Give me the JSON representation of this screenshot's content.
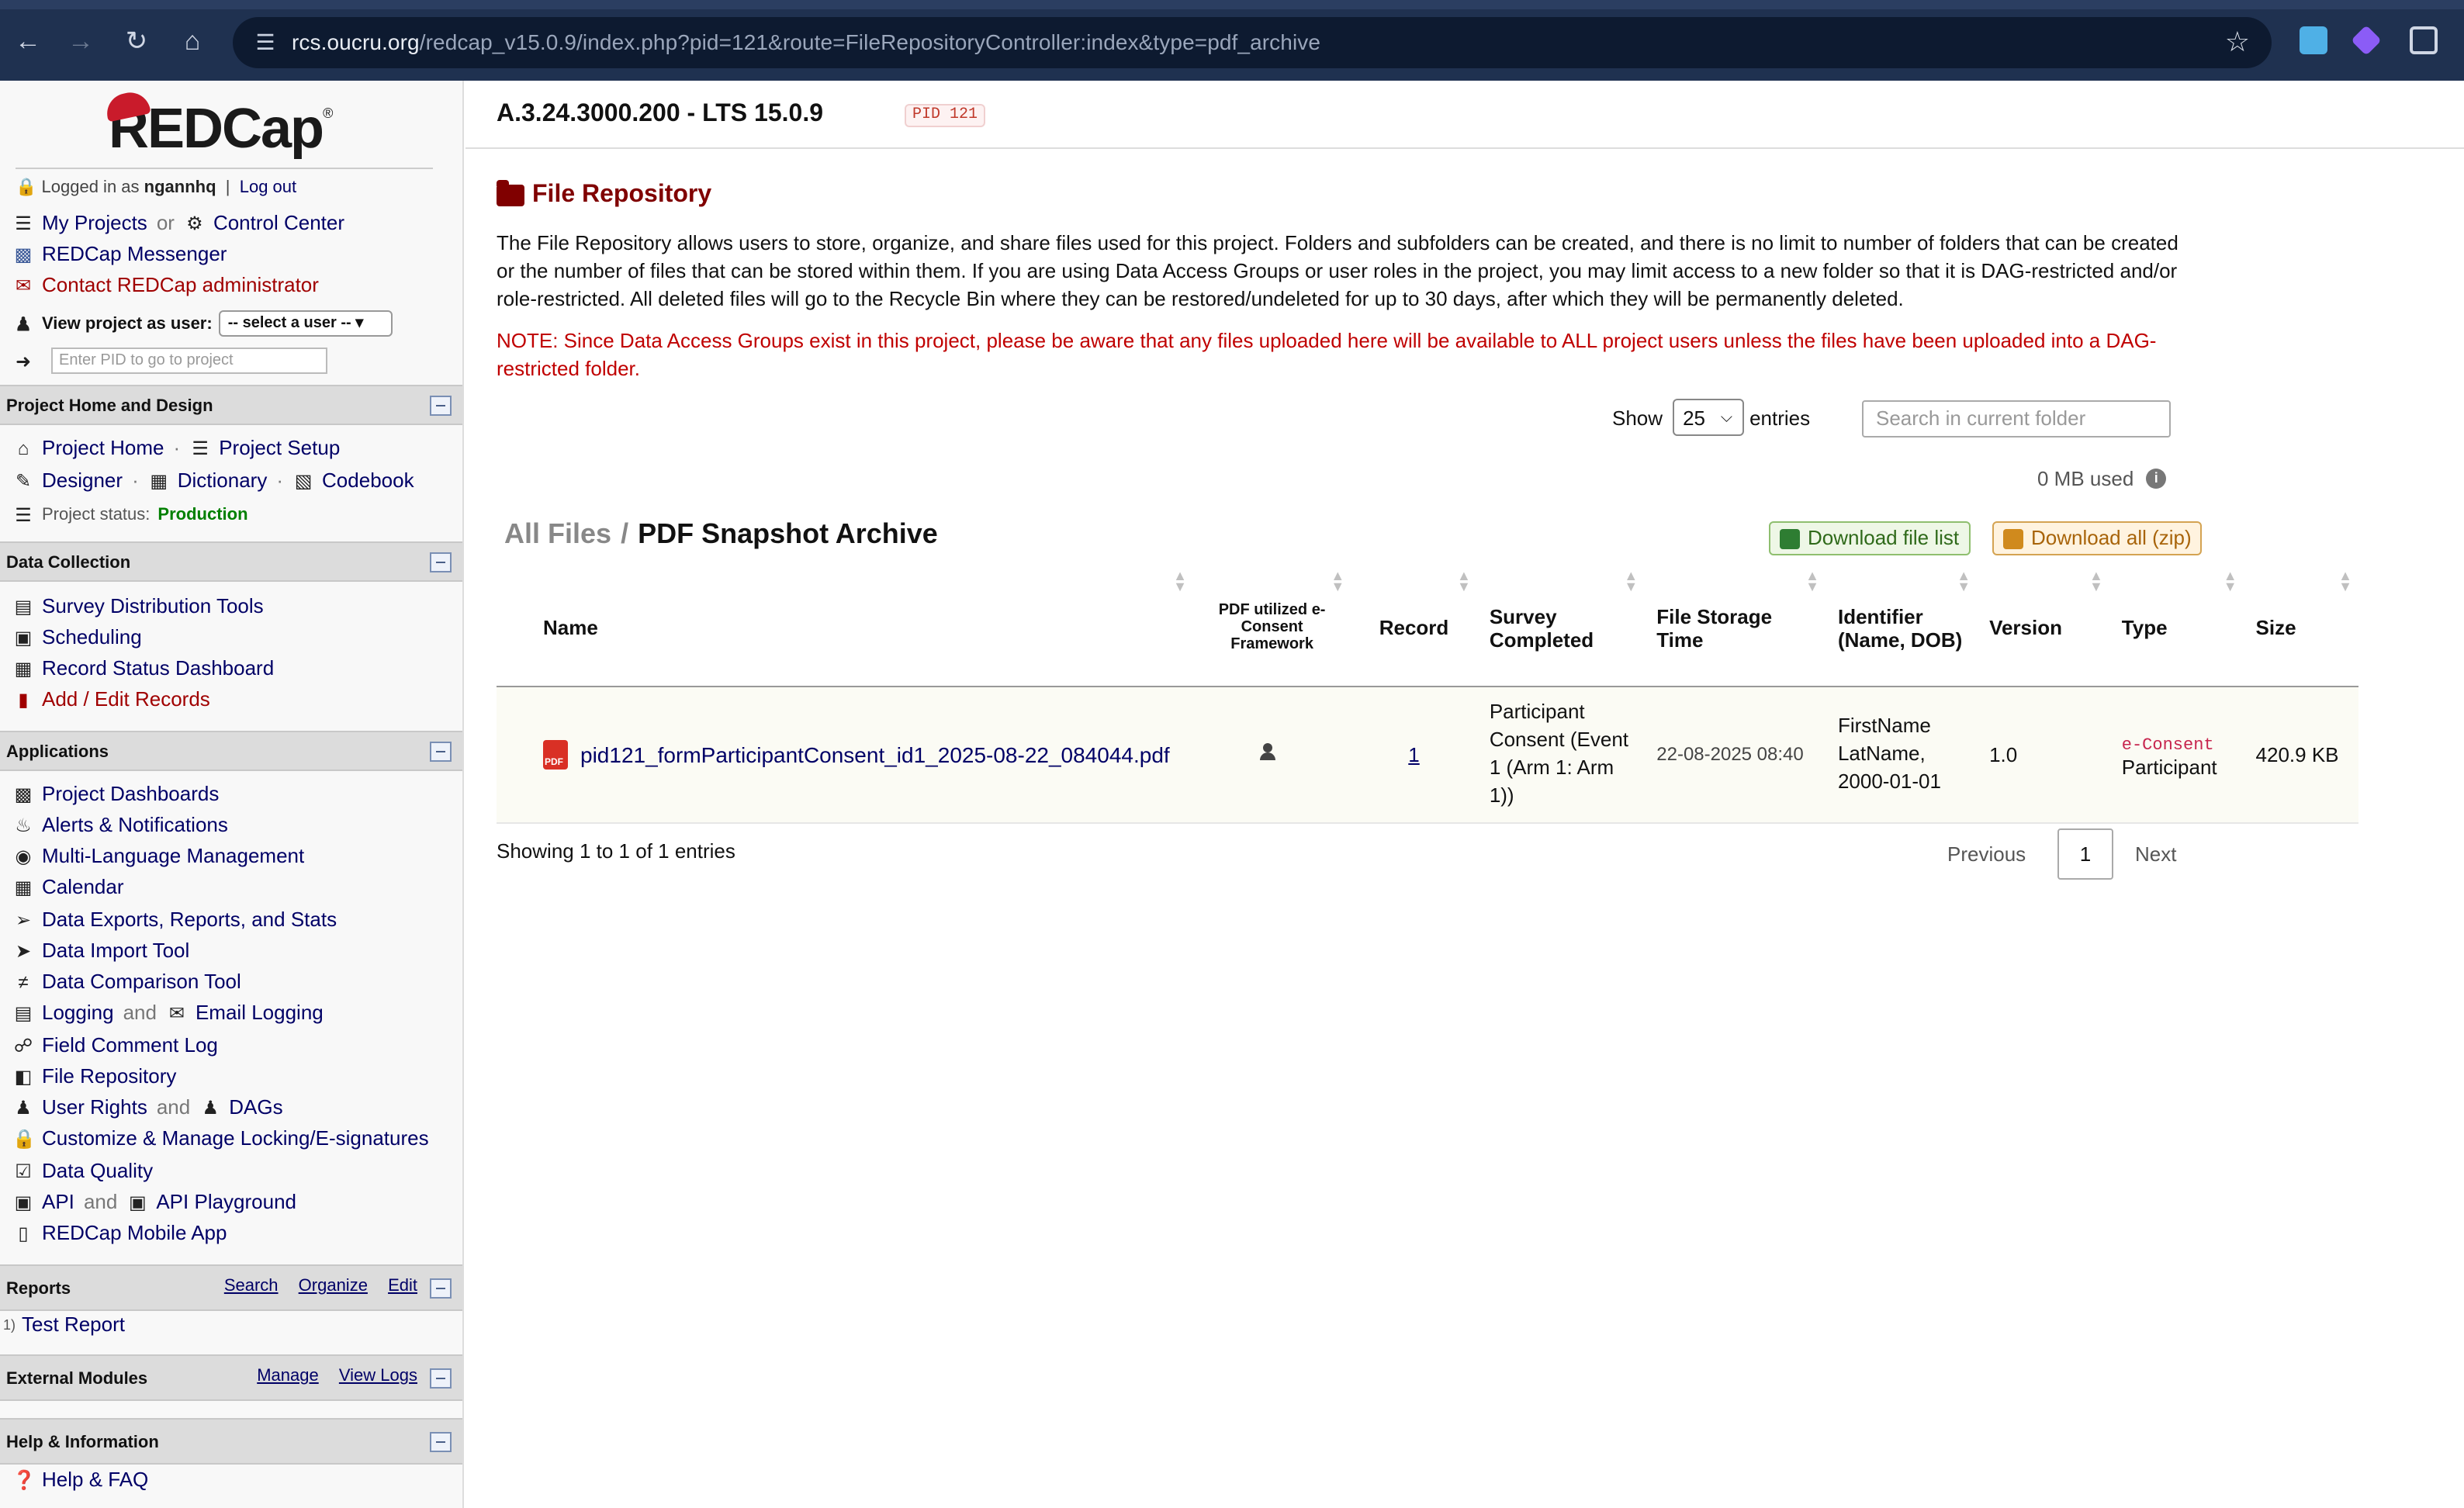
{
  "browser": {
    "url_host": "rcs.oucru.org",
    "url_path": "/redcap_v15.0.9/index.php?pid=121&route=FileRepositoryController:index&type=pdf_archive"
  },
  "sidebar": {
    "logo_text": "REDCap",
    "logo_reg": "®",
    "logged_in_label": "Logged in as",
    "username": "ngannhq",
    "logout": "Log out",
    "my_projects": "My Projects",
    "or": "or",
    "control_center": "Control Center",
    "messenger": "REDCap Messenger",
    "contact_admin": "Contact REDCap administrator",
    "view_as_label": "View project as user:",
    "view_as_value": "-- select a user --",
    "pid_placeholder": "Enter PID to go to project",
    "sections": {
      "project_home": {
        "title": "Project Home and Design",
        "project_home": "Project Home",
        "project_setup": "Project Setup",
        "designer": "Designer",
        "dictionary": "Dictionary",
        "codebook": "Codebook",
        "status_label": "Project status:",
        "status_value": "Production"
      },
      "data_collection": {
        "title": "Data Collection",
        "items": [
          "Survey Distribution Tools",
          "Scheduling",
          "Record Status Dashboard",
          "Add / Edit Records"
        ]
      },
      "applications": {
        "title": "Applications",
        "project_dashboards": "Project Dashboards",
        "alerts": "Alerts & Notifications",
        "mlm": "Multi-Language Management",
        "calendar": "Calendar",
        "exports": "Data Exports, Reports, and Stats",
        "import": "Data Import Tool",
        "comparison": "Data Comparison Tool",
        "logging": "Logging",
        "and": "and",
        "email_logging": "Email Logging",
        "field_comment": "Field Comment Log",
        "file_repo": "File Repository",
        "user_rights": "User Rights",
        "dags": "DAGs",
        "locking": "Customize & Manage Locking/E-signatures",
        "data_quality": "Data Quality",
        "api": "API",
        "api_playground": "API Playground",
        "mobile_app": "REDCap Mobile App"
      },
      "reports": {
        "title": "Reports",
        "search": "Search",
        "organize": "Organize",
        "edit": "Edit",
        "item_num": "1)",
        "item": "Test Report"
      },
      "external_modules": {
        "title": "External Modules",
        "manage": "Manage",
        "view_logs": "View Logs"
      },
      "help": {
        "title": "Help & Information",
        "faq": "Help & FAQ"
      }
    }
  },
  "main": {
    "project_title": "A.3.24.3000.200 - LTS 15.0.9",
    "pid_badge": "PID 121",
    "page_heading": "File Repository",
    "description": "The File Repository allows users to store, organize, and share files used for this project. Folders and subfolders can be created, and there is no limit to number of folders that can be created or the number of files that can be stored within them. If you are using Data Access Groups or user roles in the project, you may limit access to a new folder so that it is DAG-restricted and/or role-restricted. All deleted files will go to the Recycle Bin where they can be restored/undeleted for up to 30 days, after which they will be permanently deleted.",
    "note": "NOTE: Since Data Access Groups exist in this project, please be aware that any files uploaded here will be available to ALL project users unless the files have been uploaded into a DAG-restricted folder.",
    "show_label": "Show",
    "show_value": "25",
    "entries_label": "entries",
    "search_placeholder": "Search in current folder",
    "mb_used": "0 MB used",
    "breadcrumb_root": "All Files",
    "breadcrumb_sep": "/",
    "breadcrumb_current": "PDF Snapshot Archive",
    "download_list": "Download file list",
    "download_zip": "Download all (zip)",
    "table": {
      "headers": [
        "Name",
        "PDF utilized e-Consent Framework",
        "Record",
        "Survey Completed",
        "File Storage Time",
        "Identifier (Name, DOB)",
        "Version",
        "Type",
        "Size"
      ],
      "rows": [
        {
          "name": "pid121_formParticipantConsent_id1_2025-08-22_084044.pdf",
          "record": "1",
          "survey": "Participant Consent (Event 1 (Arm 1: Arm 1))",
          "storage_time": "22-08-2025 08:40",
          "identifier": "FirstName LatName, 2000-01-01",
          "version": "1.0",
          "type_code": "e-Consent",
          "type_label": "Participant",
          "size": "420.9 KB"
        }
      ]
    },
    "showing": "Showing 1 to 1 of 1 entries",
    "previous": "Previous",
    "page": "1",
    "next": "Next"
  }
}
